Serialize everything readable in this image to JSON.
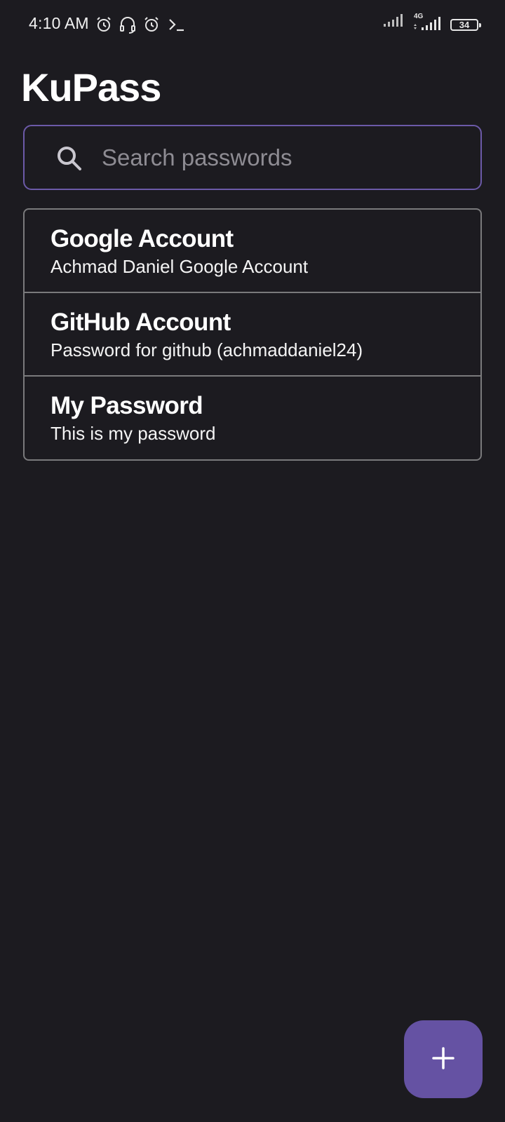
{
  "status_bar": {
    "time": "4:10 AM",
    "icons_left": [
      "alarm-icon",
      "headset-icon",
      "alarm-icon",
      "terminal-icon"
    ],
    "network_label": "4G",
    "battery": "34"
  },
  "app": {
    "title": "KuPass"
  },
  "search": {
    "placeholder": "Search passwords",
    "value": ""
  },
  "passwords": [
    {
      "title": "Google Account",
      "description": "Achmad Daniel Google Account"
    },
    {
      "title": "GitHub Account",
      "description": "Password for github (achmaddaniel24)"
    },
    {
      "title": "My Password",
      "description": "This is my password"
    }
  ],
  "fab": {
    "icon": "plus-icon"
  },
  "colors": {
    "background": "#1c1b20",
    "accent": "#6552a3",
    "search_border": "#6c5aa8",
    "divider": "#7a7a7c"
  }
}
